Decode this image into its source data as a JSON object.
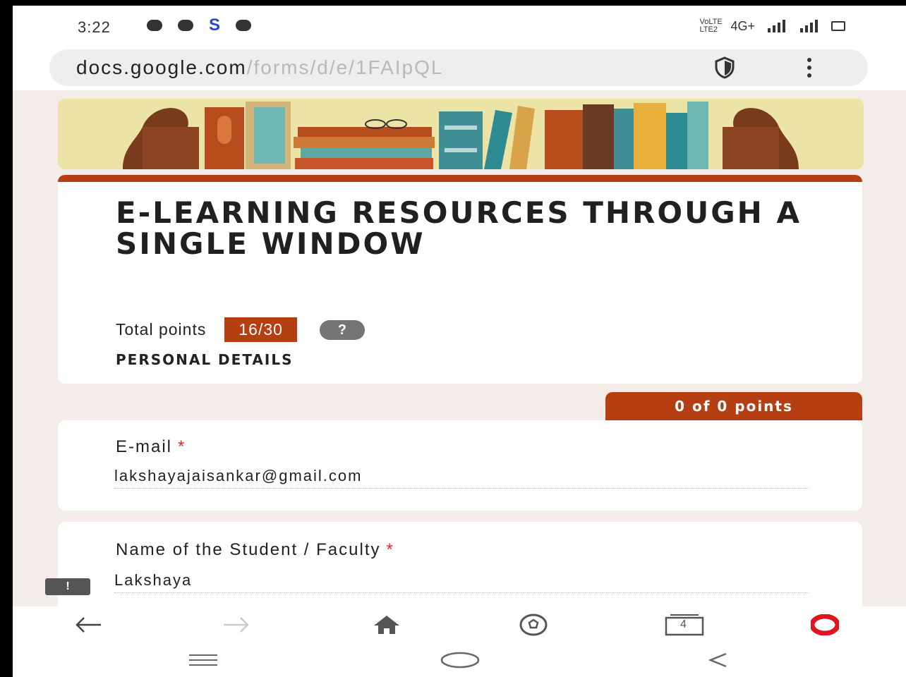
{
  "status_bar": {
    "time": "3:22",
    "network": "4G+",
    "carrier": "VoLTE LTE2",
    "s_icon": "S"
  },
  "browser": {
    "url_host": "docs.google.com",
    "url_path": "/forms/d/e/1FAIpQL",
    "shield_icon": "shield-icon",
    "menu_icon": "kebab-menu-icon"
  },
  "form": {
    "title": "E-LEARNING RESOURCES THROUGH A SINGLE WINDOW",
    "total_points_label": "Total points",
    "total_points_value": "16/30",
    "help_icon_glyph": "?",
    "section_label": "PERSONAL DETAILS",
    "section_points": "0 of 0 points",
    "questions": [
      {
        "label": "E-mail",
        "required": "*",
        "answer": "lakshayajaisankar@gmail.com"
      },
      {
        "label": "Name of the Student / Faculty",
        "required": "*",
        "answer": "Lakshaya"
      }
    ],
    "feedback_glyph": "!"
  },
  "browser_toolbar": {
    "items": [
      "back-arrow-icon",
      "forward-arrow-icon",
      "home-icon",
      "soccer-ball-icon",
      "tabs-icon",
      "opera-icon"
    ],
    "tab_count": "4"
  },
  "system_nav": {
    "items": [
      "recent-apps-icon",
      "home-circle-icon",
      "back-chevron-icon"
    ]
  },
  "colors": {
    "accent": "#b53f13",
    "page_bg": "#f4ece8",
    "required": "#d93025",
    "opera_red": "#e0141e"
  }
}
